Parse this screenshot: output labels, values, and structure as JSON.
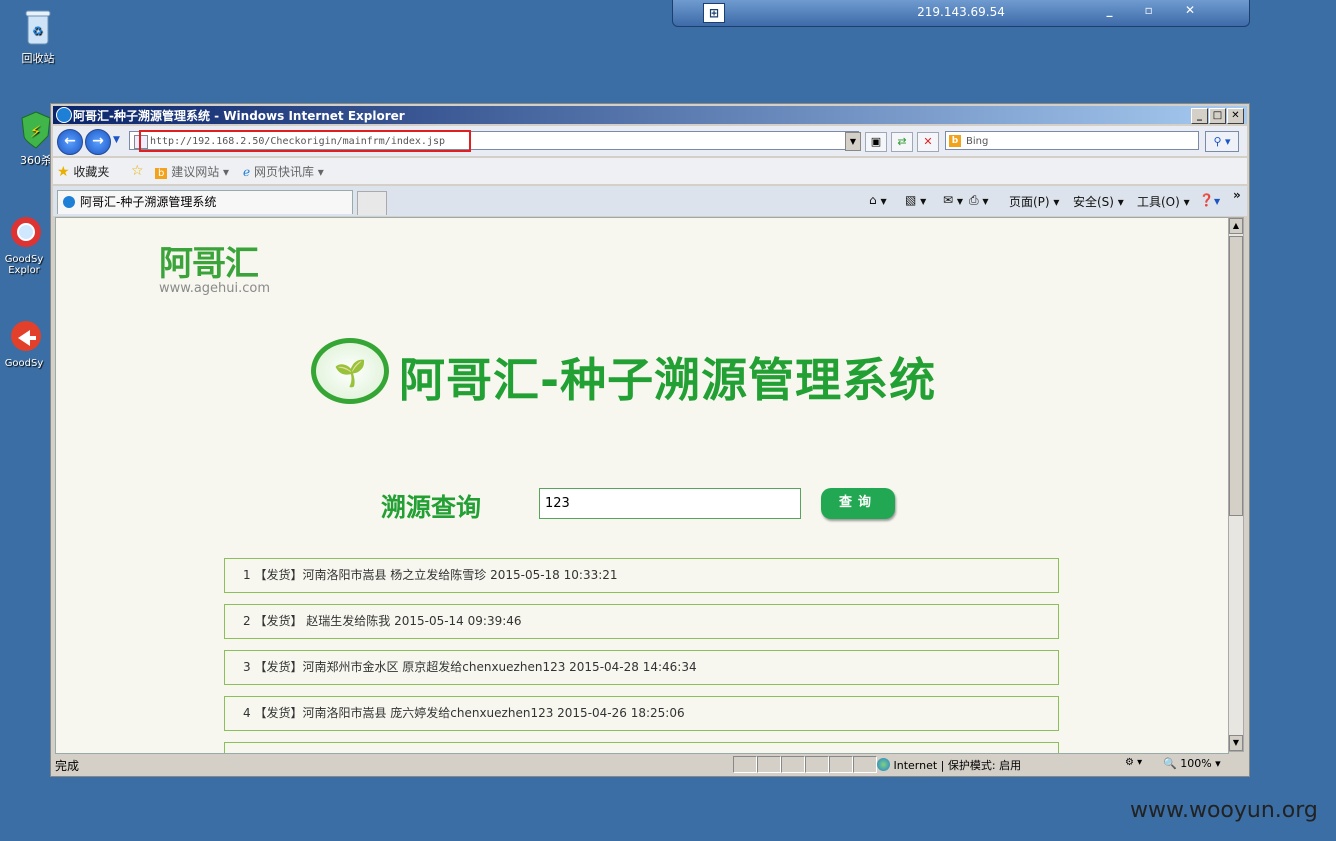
{
  "desktop": {
    "icons": [
      {
        "label": "回收站",
        "icon": "recycle-bin-icon"
      },
      {
        "label": "360杀",
        "icon": "shield-icon"
      },
      {
        "label": "GoodSy Explor",
        "icon": "magnifier-icon"
      },
      {
        "label": "GoodSy",
        "icon": "arrow-icon"
      }
    ]
  },
  "rdp": {
    "host": "219.143.69.54",
    "pin": "⊞",
    "controls": "_ ▫ ✕"
  },
  "window": {
    "title": "阿哥汇-种子溯源管理系统 - Windows Internet Explorer",
    "address": "http://192.168.2.50/Checkorigin/mainfrm/index.jsp",
    "search_placeholder": "Bing",
    "favorites": {
      "label": "收藏夹",
      "items": [
        "建议网站 ▾",
        "网页快讯库 ▾"
      ]
    },
    "tab_title": "阿哥汇-种子溯源管理系统",
    "commands": [
      "页面(P) ▾",
      "安全(S) ▾",
      "工具(O) ▾"
    ],
    "status": {
      "text": "完成",
      "zone": "Internet | 保护模式: 启用",
      "zoom": "100%"
    }
  },
  "page": {
    "logo": {
      "cn": "阿哥汇",
      "url": "www.agehui.com"
    },
    "banner_title": "阿哥汇-种子溯源管理系统",
    "query": {
      "label": "溯源查询",
      "value": "123",
      "button": "查询"
    },
    "results": [
      "1 【发货】河南洛阳市嵩县 杨之立发给陈雪珍 2015-05-18 10:33:21",
      "2 【发货】 赵瑞生发给陈我 2015-05-14 09:39:46",
      "3 【发货】河南郑州市金水区 原京超发给chenxuezhen123 2015-04-28 14:46:34",
      "4 【发货】河南洛阳市嵩县 庞六婷发给chenxuezhen123 2015-04-26 18:25:06"
    ]
  },
  "watermark": "www.wooyun.org",
  "colors": {
    "desktop": "#3a6ea5",
    "brand_green": "#22a033",
    "button_green": "#22a852",
    "highlight_red": "#e02020"
  }
}
